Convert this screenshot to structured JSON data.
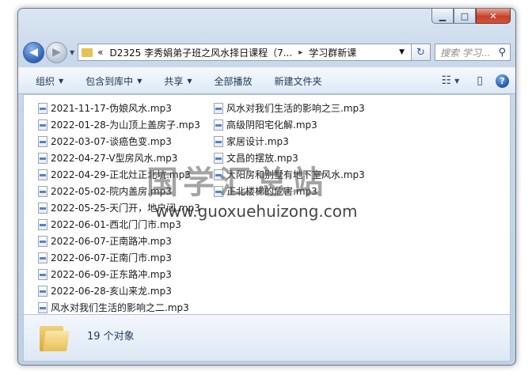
{
  "window": {
    "controls": {
      "minimize": "▁",
      "maximize": "□",
      "close": "✕"
    }
  },
  "nav": {
    "back_glyph": "◀",
    "forward_glyph": "▶",
    "dropdown_glyph": "▼",
    "address_prefix": "«",
    "path_root": "D2325 李秀娟弟子班之风水择日课程（7...",
    "path_sep": "▸",
    "path_current": "学习群新课",
    "address_dropdown": "▼",
    "refresh_glyph": "↻",
    "search_placeholder": "搜索 学习...",
    "search_glyph": "⚲"
  },
  "toolbar": {
    "organize": "组织",
    "include_library": "包含到库中",
    "share": "共享",
    "play_all": "全部播放",
    "new_folder": "新建文件夹",
    "caret": "▼",
    "views_glyph": "☷",
    "preview_glyph": "▯",
    "help_glyph": "?"
  },
  "files_col1": [
    "2021-11-17-伪娘风水.mp3",
    "2022-01-28-为山顶上盖房子.mp3",
    "2022-03-07-谈癌色变.mp3",
    "2022-04-27-V型房风水.mp3",
    "2022-04-29-正北灶正北坑.mp3",
    "2022-05-02-院内盖房.mp3",
    "2022-05-25-天门开，地户闭.mp3",
    "2022-06-01-西北门门市.mp3",
    "2022-06-07-正南路冲.mp3",
    "2022-06-07-正南门市.mp3",
    "2022-06-09-正东路冲.mp3",
    "2022-06-28-亥山来龙.mp3",
    "风水对我们生活的影响之二.mp3"
  ],
  "files_col2": [
    "风水对我们生活的影响之三.mp3",
    "高级阴阳宅化解.mp3",
    "家居设计.mp3",
    "文昌的摆放.mp3",
    "大阳房和别墅有地下室风水.mp3",
    "正北楼梯的危害.mp3"
  ],
  "status": {
    "count": "19 个对象"
  },
  "watermark": {
    "cn": "国学汇总站",
    "url": "www.guoxuehuizong.com"
  }
}
